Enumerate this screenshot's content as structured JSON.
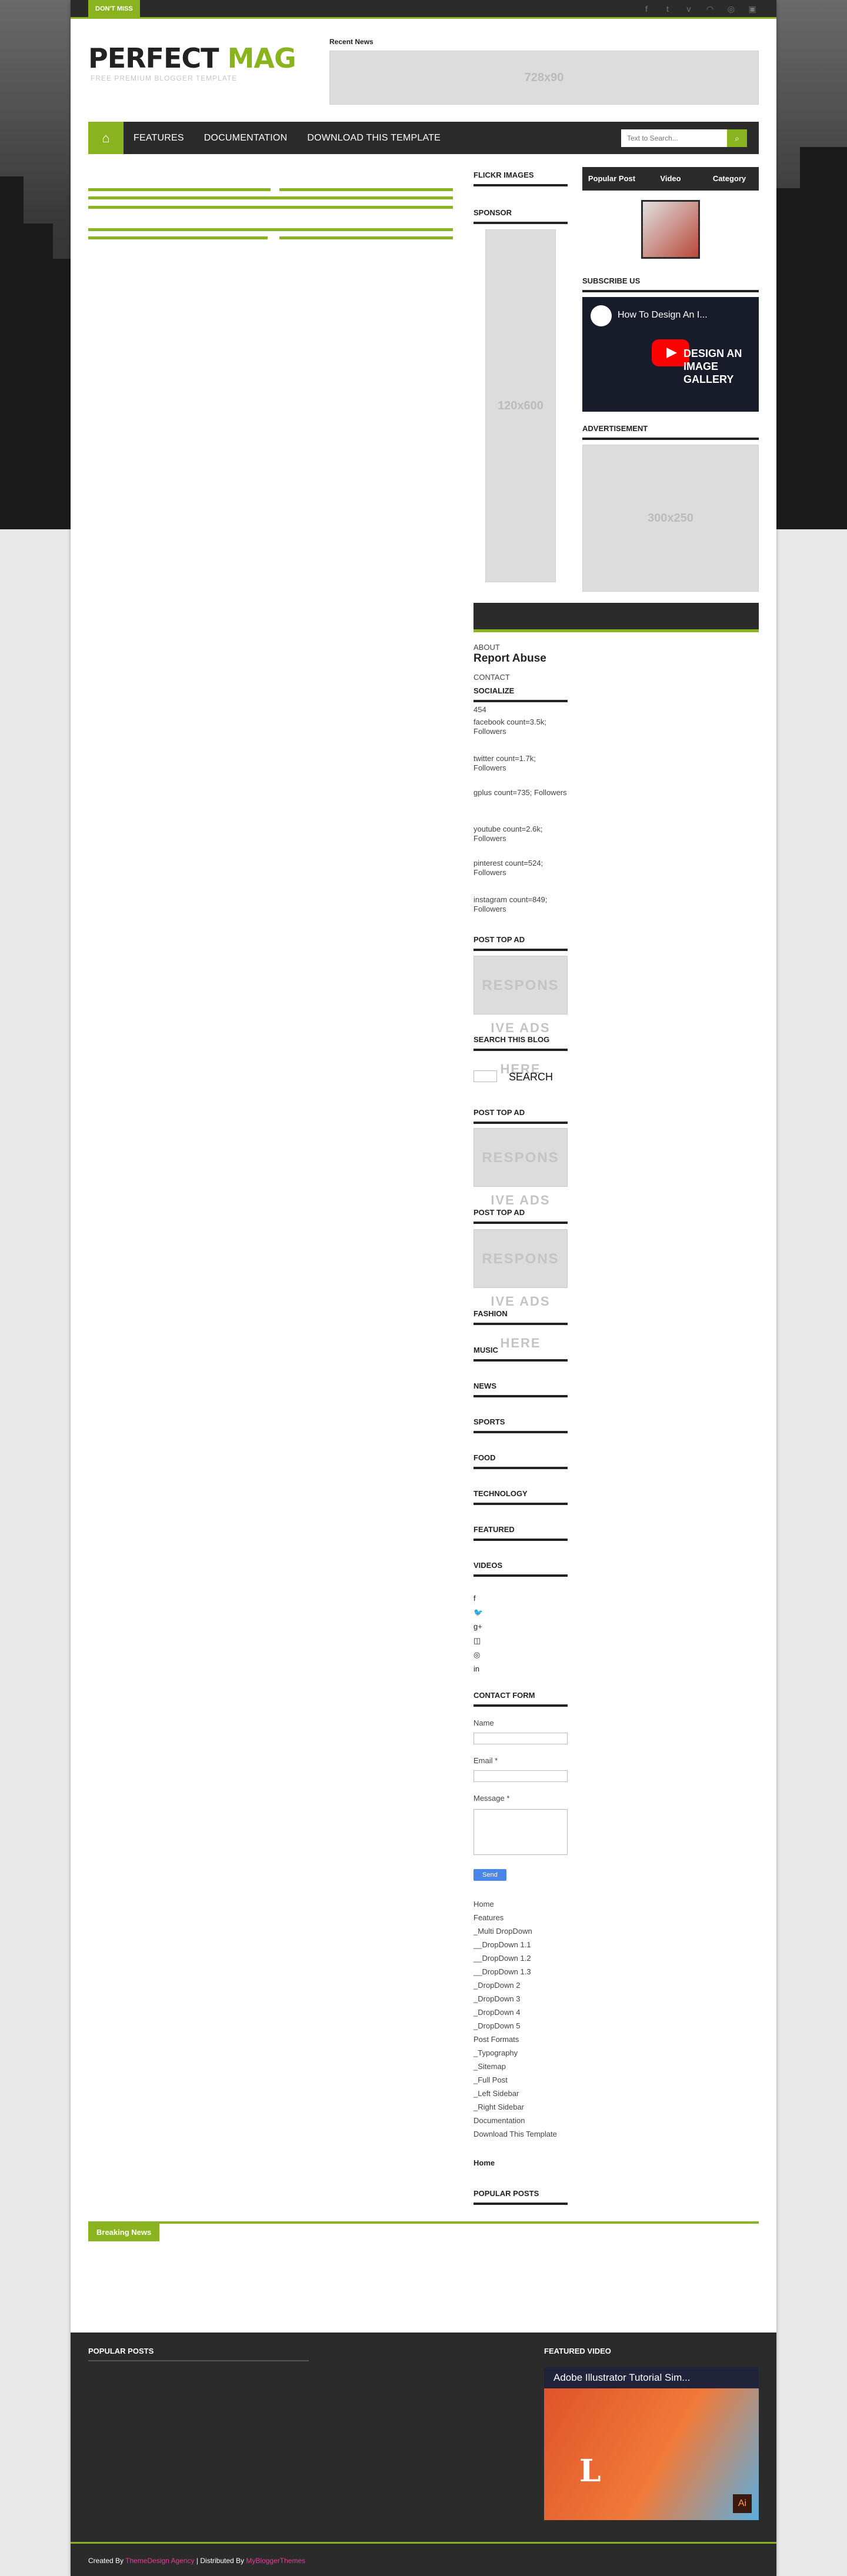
{
  "topbar": {
    "dont_miss": "DON'T MISS",
    "social_icons": [
      "facebook-icon",
      "twitter-icon",
      "vimeo-icon",
      "rss-icon",
      "dribbble-icon",
      "linkedin-icon"
    ]
  },
  "header": {
    "logo_part1": "PERFECT",
    "logo_part2": "MAG",
    "tagline": "FREE PREMIUM BLOGGER TEMPLATE",
    "recent_news": "Recent News",
    "ad_label": "728x90"
  },
  "nav": {
    "home_icon": "home-icon",
    "items": [
      "FEATURES",
      "DOCUMENTATION",
      "DOWNLOAD THIS TEMPLATE"
    ],
    "search_placeholder": "Text to Search..."
  },
  "sidebar_left": {
    "flickr_title": "FLICKR IMAGES",
    "sponsor_title": "SPONSOR",
    "sponsor_ad": "120x600",
    "about": "ABOUT",
    "report_abuse": "Report Abuse",
    "contact": "CONTACT",
    "socialize_title": "SOCIALIZE",
    "socialize_count": "454",
    "social_counts": [
      "facebook count=3.5k; Followers",
      "twitter count=1.7k; Followers",
      "gplus count=735; Followers",
      "youtube count=2.6k; Followers",
      "pinterest count=524; Followers",
      "instagram count=849; Followers"
    ],
    "post_top_ad": "POST TOP AD",
    "responsive_text": [
      "RESPONS",
      "IVE ADS",
      "HERE"
    ],
    "search_blog_title": "SEARCH THIS BLOG",
    "search_button": "SEARCH",
    "categories": [
      "FASHION",
      "MUSIC",
      "NEWS",
      "SPORTS",
      "FOOD",
      "TECHNOLOGY",
      "FEATURED",
      "VIDEOS"
    ],
    "social_icon_list": [
      "f",
      "🐦",
      "g+",
      "◫",
      "◎",
      "in"
    ],
    "contact_form_title": "CONTACT FORM",
    "name_label": "Name",
    "email_label": "Email *",
    "message_label": "Message *",
    "send_label": "Send",
    "menu_items": [
      "Home",
      "Features",
      "_Multi DropDown",
      "__DropDown 1.1",
      "__DropDown 1.2",
      "__DropDown 1.3",
      "_DropDown 2",
      "_DropDown 3",
      "_DropDown 4",
      "_DropDown 5",
      "Post Formats",
      "_Typography",
      "_Sitemap",
      "_Full Post",
      "_Left Sidebar",
      "_Right Sidebar",
      "Documentation",
      "Download This Template"
    ],
    "home_link": "Home",
    "popular_posts_title": "POPULAR POSTS"
  },
  "sidebar_right": {
    "tabs": [
      "Popular Post",
      "Video",
      "Category"
    ],
    "subscribe_title": "SUBSCRIBE US",
    "yt_title": "How To Design An I...",
    "yt_overlay": "DESIGN AN IMAGE GALLERY",
    "advertisement_title": "ADVERTISEMENT",
    "ad300": "300x250"
  },
  "breaking": {
    "label": "Breaking News"
  },
  "footer": {
    "popular_posts": "POPULAR POSTS",
    "featured_video": "FEATURED VIDEO",
    "video_title": "Adobe Illustrator Tutorial Sim...",
    "created_by": "Created By",
    "creator": "ThemeDesign Agency",
    "distributed_by": "| Distributed By",
    "distributor": "MyBloggerThemes"
  }
}
